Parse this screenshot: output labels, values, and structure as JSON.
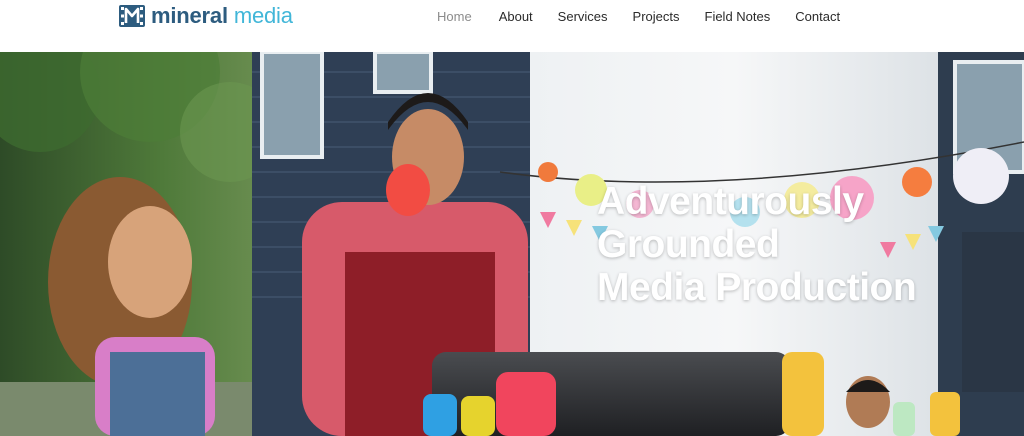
{
  "brand": {
    "name_strong": "mineral",
    "name_light": "media",
    "logo_icon": "film-m-icon",
    "colors": {
      "primary": "#2d5c7f",
      "accent": "#41b6d8"
    }
  },
  "nav": {
    "active": "Home",
    "items": [
      {
        "id": "home",
        "label": "Home"
      },
      {
        "id": "about",
        "label": "About"
      },
      {
        "id": "services",
        "label": "Services"
      },
      {
        "id": "projects",
        "label": "Projects"
      },
      {
        "id": "field-notes",
        "label": "Field Notes"
      },
      {
        "id": "contact",
        "label": "Contact"
      }
    ]
  },
  "hero": {
    "headline_lines": [
      "Adventurously",
      "Grounded",
      "Media Production"
    ]
  }
}
